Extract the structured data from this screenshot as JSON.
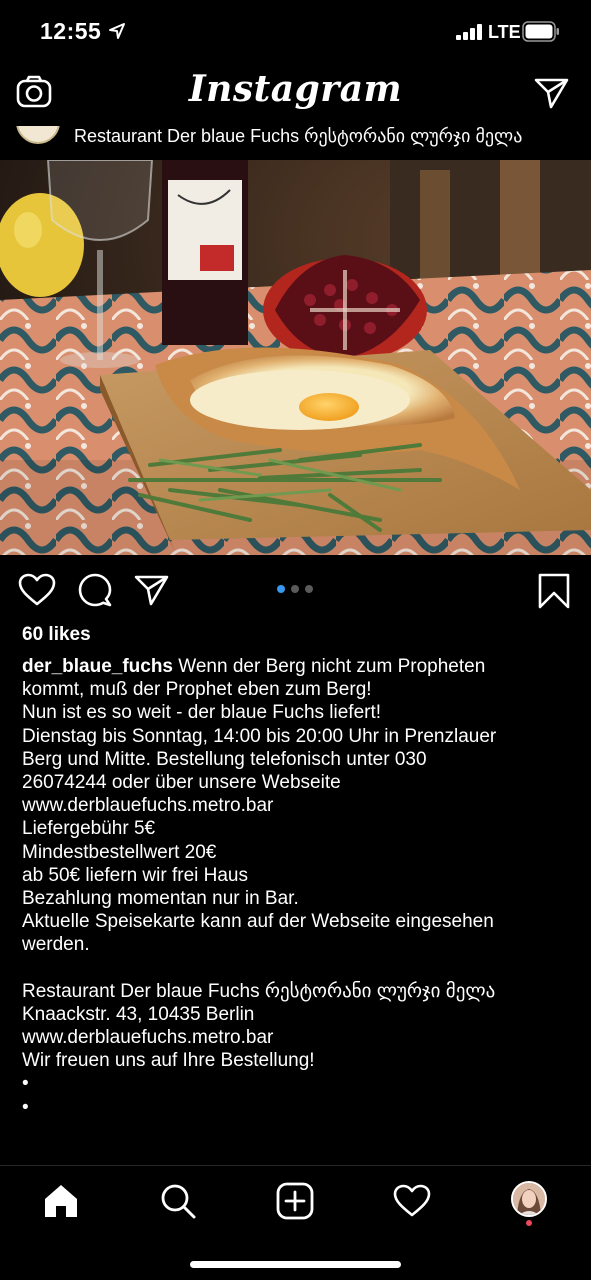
{
  "status_bar": {
    "time": "12:55",
    "network": "LTE"
  },
  "header": {
    "app_title": "Instagram"
  },
  "post": {
    "author_display": "Restaurant Der blaue Fuchs რესტორანი ლურჯი მელა",
    "carousel": {
      "count": 3,
      "active": 1
    },
    "likes": "60 likes",
    "username": "der_blaue_fuchs",
    "caption_first": " Wenn der Berg nicht zum Propheten",
    "caption_lines": [
      "kommt, muß der Prophet eben zum Berg!",
      "Nun ist es so weit - der blaue Fuchs liefert!",
      "Dienstag bis Sonntag, 14:00 bis 20:00 Uhr in Prenzlauer",
      "Berg und Mitte. Bestellung telefonisch unter 030",
      "26074244 oder über unsere Webseite",
      "www.derblauefuchs.metro.bar",
      "Liefergebühr 5€",
      "Mindestbestellwert 20€",
      "ab 50€ liefern wir frei Haus",
      "Bezahlung momentan nur in Bar.",
      "Aktuelle Speisekarte kann auf der Webseite eingesehen",
      "werden.",
      "",
      "Restaurant Der blaue Fuchs რესტორანი ლურჯი მელა",
      "Knaackstr. 43, 10435 Berlin",
      "www.derblauefuchs.metro.bar",
      "Wir freuen uns auf Ihre Bestellung!",
      "•",
      "•"
    ]
  },
  "icons": {
    "top_left": "camera-icon",
    "top_right": "direct-message-icon",
    "actions": [
      "heart-icon",
      "comment-icon",
      "share-icon",
      "bookmark-icon"
    ],
    "tabs": [
      "home-icon",
      "search-icon",
      "new-post-icon",
      "activity-icon",
      "profile-avatar"
    ]
  },
  "colors": {
    "background": "#000000",
    "carousel_active": "#3897f0",
    "notification": "#ed4956"
  }
}
